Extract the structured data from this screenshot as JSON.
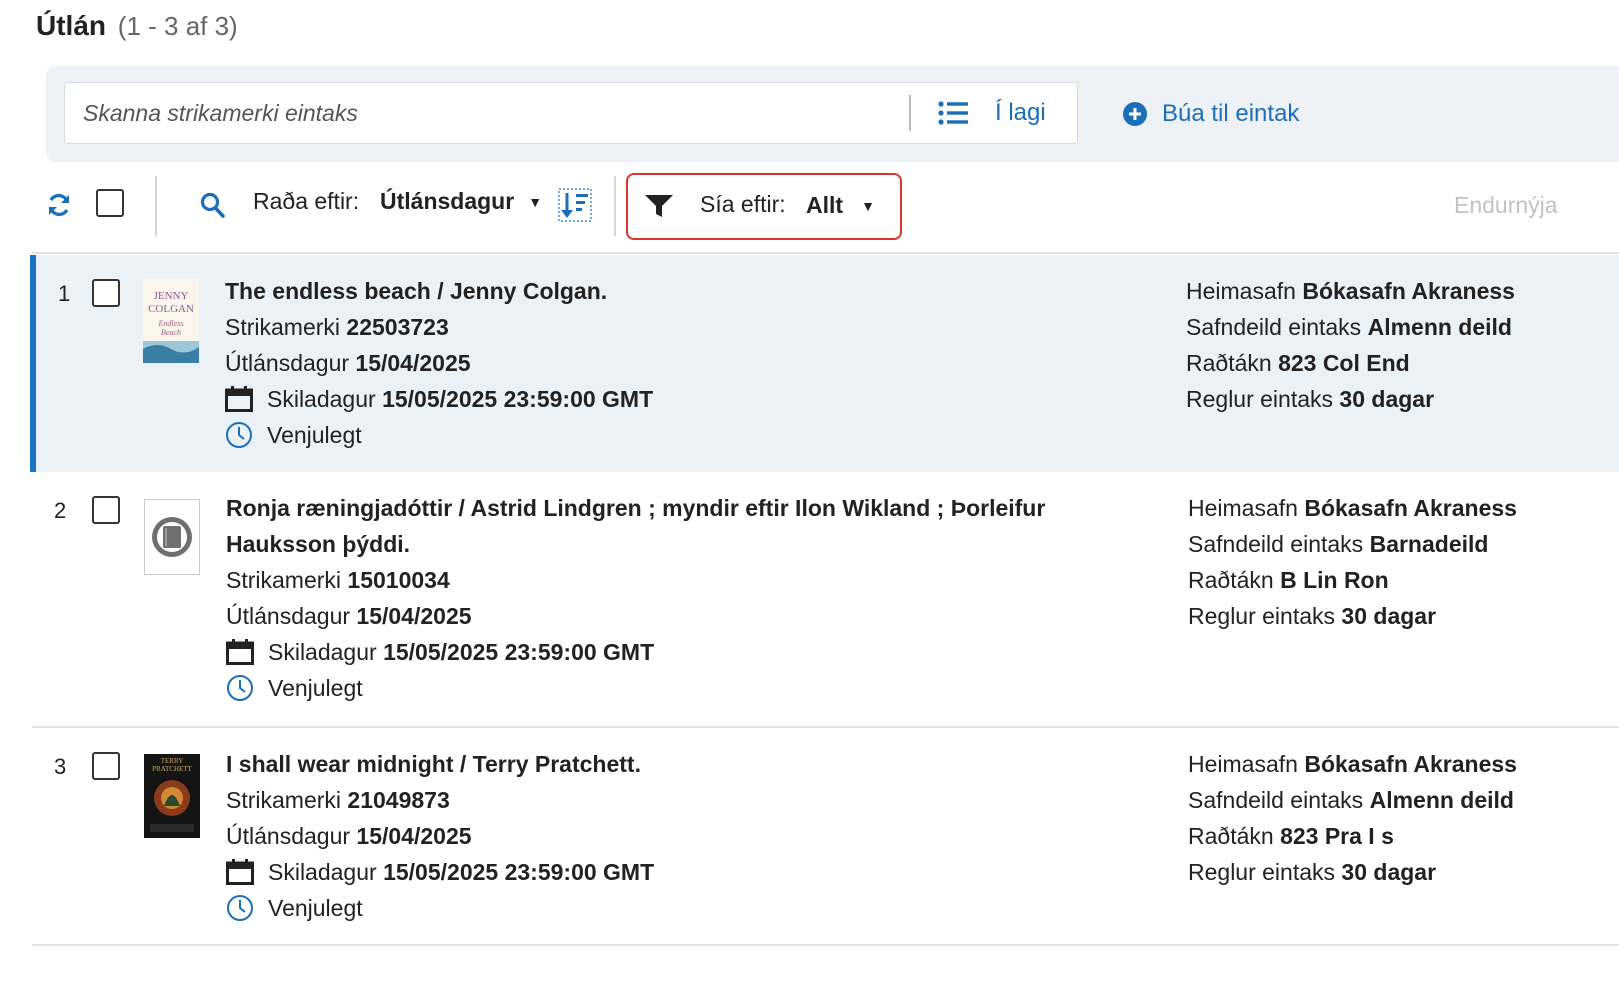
{
  "header": {
    "title": "Útlán",
    "count": "(1 - 3 af 3)"
  },
  "scan": {
    "placeholder": "Skanna strikamerki eintaks",
    "ok_label": "Í lagi",
    "create_label": "Búa til eintak"
  },
  "toolbar": {
    "sort_label": "Raða eftir:",
    "sort_value": "Útlánsdagur",
    "filter_label": "Sía eftir:",
    "filter_value": "Allt",
    "renew_label": "Endurnýja"
  },
  "labels": {
    "barcode": "Strikamerki",
    "loan_date": "Útlánsdagur",
    "due_date": "Skiladagur",
    "home_library": "Heimasafn",
    "location": "Safndeild eintaks",
    "call_number": "Raðtákn",
    "policy": "Reglur eintaks"
  },
  "loans": [
    {
      "num": "1",
      "title": "The endless beach / Jenny Colgan.",
      "barcode": "22503723",
      "loan_date": "15/04/2025",
      "due_date": "15/05/2025 23:59:00 GMT",
      "status": "Venjulegt",
      "home_library": "Bókasafn Akraness",
      "location": "Almenn deild",
      "call_number": "823 Col End",
      "policy": "30 dagar",
      "cover": "cover-endless-beach",
      "cover_text": [
        "JENNY",
        "COLGAN",
        "Endless",
        "Beach"
      ]
    },
    {
      "num": "2",
      "title": "Ronja ræningjadóttir / Astrid Lindgren ; myndir eftir Ilon Wikland ; Þorleifur Hauksson þýddi.",
      "barcode": "15010034",
      "loan_date": "15/04/2025",
      "due_date": "15/05/2025 23:59:00 GMT",
      "status": "Venjulegt",
      "home_library": "Bókasafn Akraness",
      "location": "Barnadeild",
      "call_number": "B Lin Ron",
      "policy": "30 dagar",
      "cover": "placeholder-book-icon"
    },
    {
      "num": "3",
      "title": "I shall wear midnight / Terry Pratchett.",
      "barcode": "21049873",
      "loan_date": "15/04/2025",
      "due_date": "15/05/2025 23:59:00 GMT",
      "status": "Venjulegt",
      "home_library": "Bókasafn Akraness",
      "location": "Almenn deild",
      "call_number": "823 Pra I s",
      "policy": "30 dagar",
      "cover": "cover-i-shall-wear-midnight",
      "cover_text": [
        "TERRY",
        "PRATCHETT"
      ]
    }
  ],
  "colors": {
    "accent": "#1a6fb8",
    "selected_row": "#eaf1f7",
    "selected_border": "#1a73c6",
    "filter_highlight": "#d9362b",
    "scan_bar": "#eef2f6"
  }
}
